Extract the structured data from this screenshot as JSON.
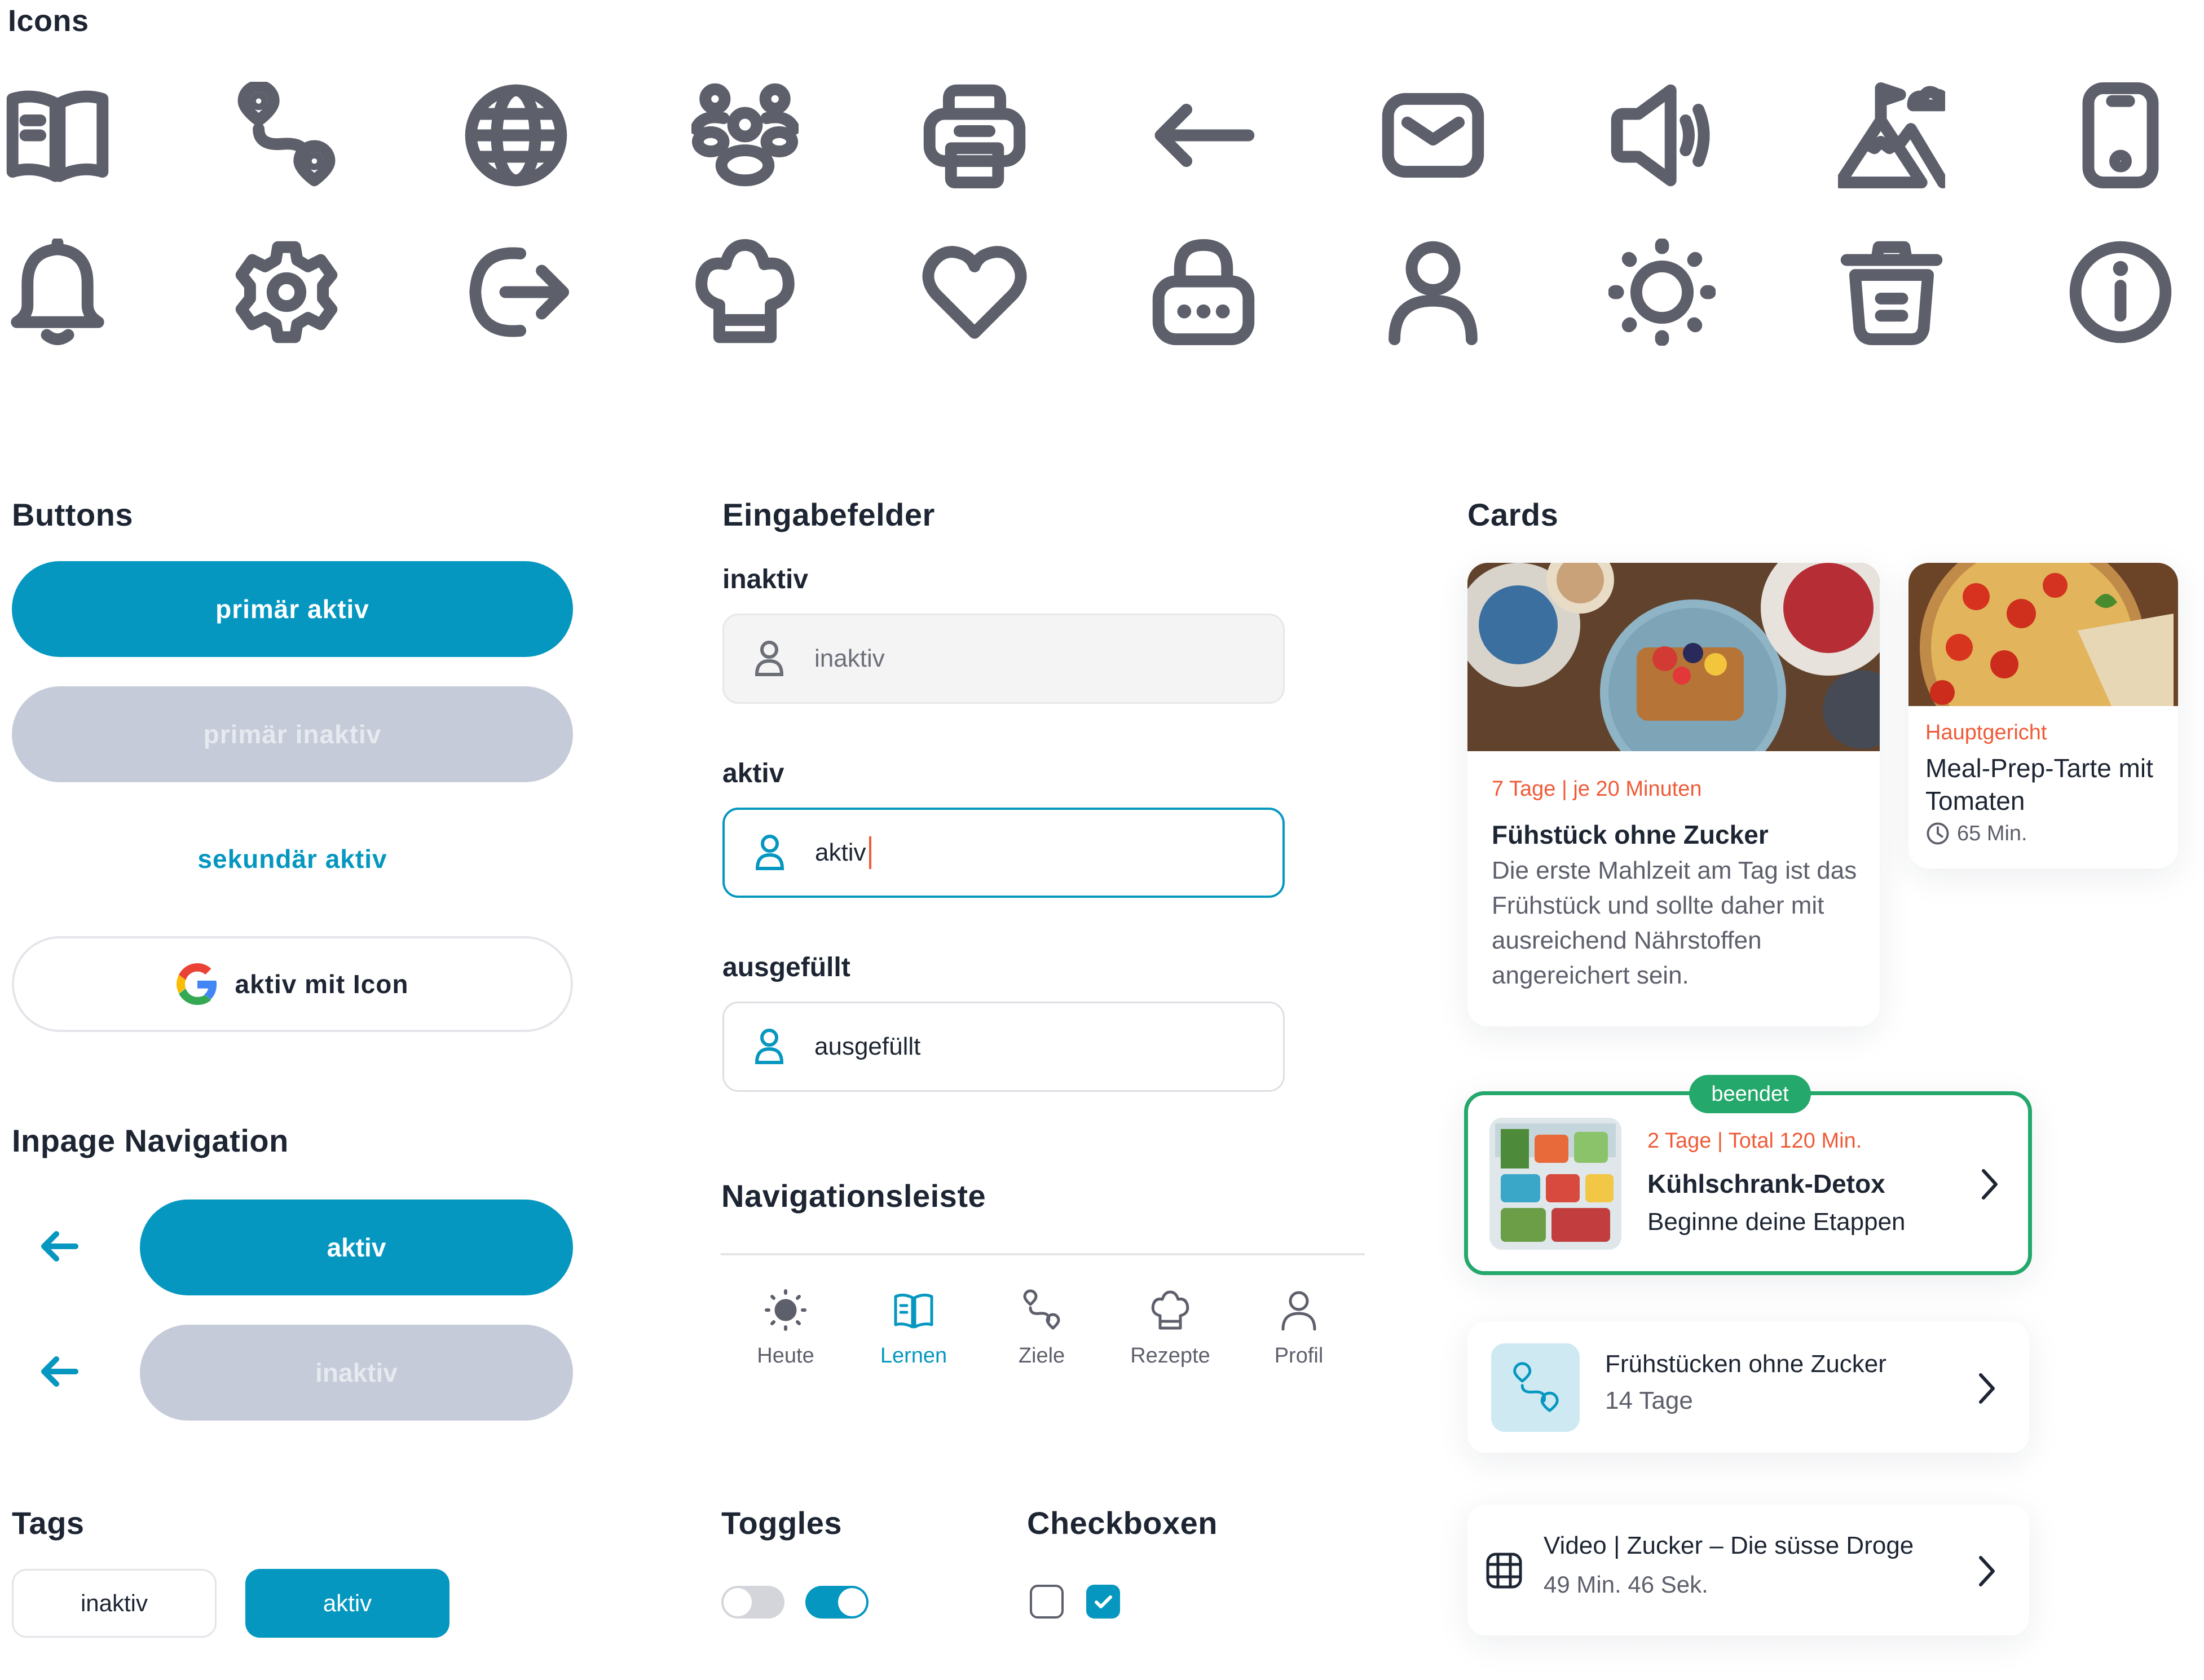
{
  "sections": {
    "icons": "Icons",
    "buttons": "Buttons",
    "inputs": "Eingabefelder",
    "cards": "Cards",
    "inpage_nav": "Inpage Navigation",
    "navbar": "Navigationsleiste",
    "tags": "Tags",
    "toggles": "Toggles",
    "checkboxes": "Checkboxen"
  },
  "icons": [
    "book-icon",
    "route-icon",
    "globe-icon",
    "group-icon",
    "printer-icon",
    "arrow-left-icon",
    "mail-icon",
    "speaker-icon",
    "mountain-icon",
    "phone-icon",
    "bell-icon",
    "gear-icon",
    "logout-icon",
    "chef-hat-icon",
    "heart-icon",
    "lock-icon",
    "user-icon",
    "sun-icon",
    "trash-icon",
    "info-icon"
  ],
  "buttons": {
    "primary_active": "primär aktiv",
    "primary_inactive": "primär inaktiv",
    "secondary_active": "sekundär aktiv",
    "icon_active": "aktiv mit Icon"
  },
  "inputs": {
    "inactive": {
      "label": "inaktiv",
      "value": "inaktiv"
    },
    "active": {
      "label": "aktiv",
      "value": "aktiv"
    },
    "filled": {
      "label": "ausgefüllt",
      "value": "ausgefüllt"
    }
  },
  "inpage_nav": {
    "active": "aktiv",
    "inactive": "inaktiv"
  },
  "navbar": {
    "items": [
      {
        "label": "Heute",
        "icon": "sun-icon",
        "active": false
      },
      {
        "label": "Lernen",
        "icon": "book-icon",
        "active": true
      },
      {
        "label": "Ziele",
        "icon": "route-icon",
        "active": false
      },
      {
        "label": "Rezepte",
        "icon": "chef-hat-icon",
        "active": false
      },
      {
        "label": "Profil",
        "icon": "user-icon",
        "active": false
      }
    ]
  },
  "tags": {
    "inactive": "inaktiv",
    "active": "aktiv"
  },
  "toggles": [
    {
      "on": false
    },
    {
      "on": true
    }
  ],
  "checkboxes": [
    {
      "checked": false
    },
    {
      "checked": true
    }
  ],
  "cards": {
    "breakfast": {
      "meta": "7 Tage | je 20 Minuten",
      "title": "Fühstück ohne Zucker",
      "body": "Die erste Mahlzeit am Tag ist das Frühstück und sollte daher mit ausreichend Nährstoffen angereichert sein."
    },
    "tarte": {
      "category": "Hauptgericht",
      "title": "Meal-Prep-Tarte mit Tomaten",
      "time": "65 Min."
    },
    "detox": {
      "badge": "beendet",
      "meta": "2 Tage | Total 120 Min.",
      "title": "Kühlschrank-Detox",
      "subtitle": "Beginne deine Etappen"
    },
    "goal": {
      "title": "Frühstücken ohne Zucker",
      "subtitle": "14 Tage"
    },
    "video": {
      "title": "Video | Zucker – Die süsse Droge",
      "subtitle": "49 Min. 46 Sek."
    }
  },
  "colors": {
    "primary": "#0597c0",
    "disabled": "#c5cbd8",
    "text": "#1d2533",
    "icon": "#5d5f6b",
    "accent_red": "#ef5b38",
    "success": "#25a86b"
  }
}
